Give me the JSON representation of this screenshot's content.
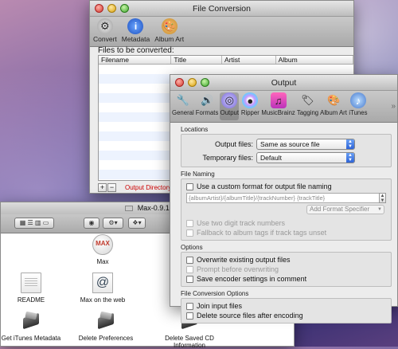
{
  "file_conversion": {
    "title": "File Conversion",
    "toolbar": [
      {
        "label": "Convert",
        "icon": "gear-icon"
      },
      {
        "label": "Metadata",
        "icon": "info-icon"
      },
      {
        "label": "Album Art",
        "icon": "palette-icon"
      }
    ],
    "files_label": "Files to be converted:",
    "columns": [
      "Filename",
      "Title",
      "Artist",
      "Album"
    ],
    "warning": "Output Directory not s"
  },
  "output_window": {
    "title": "Output",
    "toolbar": [
      {
        "label": "General",
        "icon": "wrench-icon"
      },
      {
        "label": "Formats",
        "icon": "speaker-icon"
      },
      {
        "label": "Output",
        "icon": "output-icon"
      },
      {
        "label": "Ripper",
        "icon": "disc-icon"
      },
      {
        "label": "MusicBrainz",
        "icon": "musicbrainz-icon"
      },
      {
        "label": "Tagging",
        "icon": "tag-icon"
      },
      {
        "label": "Album Art",
        "icon": "palette-icon"
      },
      {
        "label": "iTunes",
        "icon": "itunes-icon"
      }
    ],
    "locations": {
      "section": "Locations",
      "output_label": "Output files:",
      "output_value": "Same as source file",
      "temp_label": "Temporary files:",
      "temp_value": "Default"
    },
    "naming": {
      "section": "File Naming",
      "custom_format": "Use a custom format for output file naming",
      "format_value": "{albumArtist}/{albumTitle}/{trackNumber} {trackTitle}",
      "add_format": "Add Format Specifier",
      "two_digit": "Use two digit track numbers",
      "fallback": "Fallback to album tags if track tags unset"
    },
    "options": {
      "section": "Options",
      "overwrite": "Overwrite existing output files",
      "prompt": "Prompt before overwriting",
      "save_settings": "Save encoder settings in comment"
    },
    "conversion": {
      "section": "File Conversion Options",
      "join": "Join input files",
      "delete": "Delete source files after encoding"
    }
  },
  "finder": {
    "title": "Max-0.9.1",
    "items": [
      {
        "label": "Max"
      },
      {
        "label": "README"
      },
      {
        "label": "Max on the web"
      },
      {
        "label": "Get iTunes Metadata"
      },
      {
        "label": "Delete Preferences"
      },
      {
        "label": "Delete Saved CD Information"
      }
    ]
  },
  "colors": {
    "warning": "#cc0000",
    "selection": "#2e63d6"
  }
}
